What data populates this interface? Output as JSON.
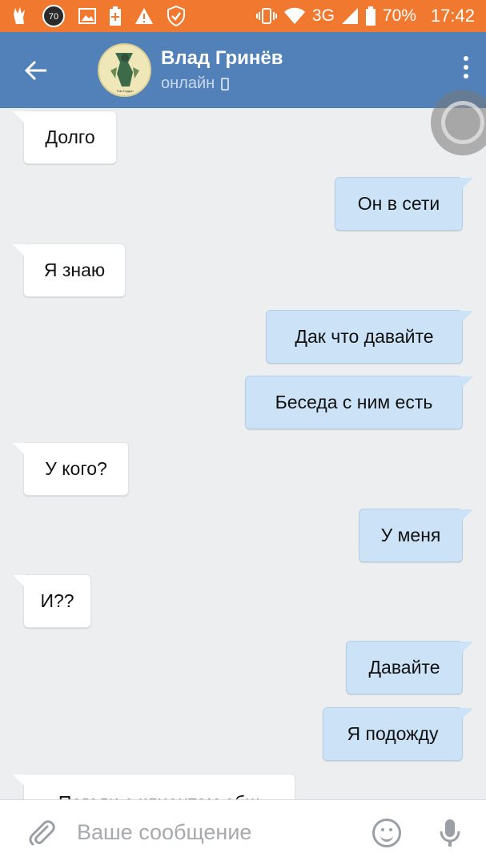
{
  "status_bar": {
    "notif_count": "70",
    "network": "3G",
    "battery": "70%",
    "time": "17:42"
  },
  "header": {
    "contact_name": "Влад Гринёв",
    "contact_status": "онлайн",
    "avatar_caption": "Том Гордон"
  },
  "messages": [
    {
      "side": "in",
      "text": "Долго"
    },
    {
      "side": "out",
      "text": "Он в сети"
    },
    {
      "side": "in",
      "text": "Я знаю"
    },
    {
      "side": "out",
      "text": "Дак что давайте"
    },
    {
      "side": "out",
      "text": "Беседа с ним есть"
    },
    {
      "side": "in",
      "text": "У кого?"
    },
    {
      "side": "out",
      "text": "У меня"
    },
    {
      "side": "in",
      "text": "И??"
    },
    {
      "side": "out",
      "text": "Давайте"
    },
    {
      "side": "out",
      "text": "Я подожду"
    },
    {
      "side": "in",
      "text": "Погоди с клиентом общ"
    }
  ],
  "composer": {
    "placeholder": "Ваше сообщение"
  },
  "colors": {
    "status_bar": "#f0792f",
    "header": "#5181b8",
    "chat_bg": "#edeef0",
    "bubble_in": "#ffffff",
    "bubble_out": "#cce3f7"
  }
}
